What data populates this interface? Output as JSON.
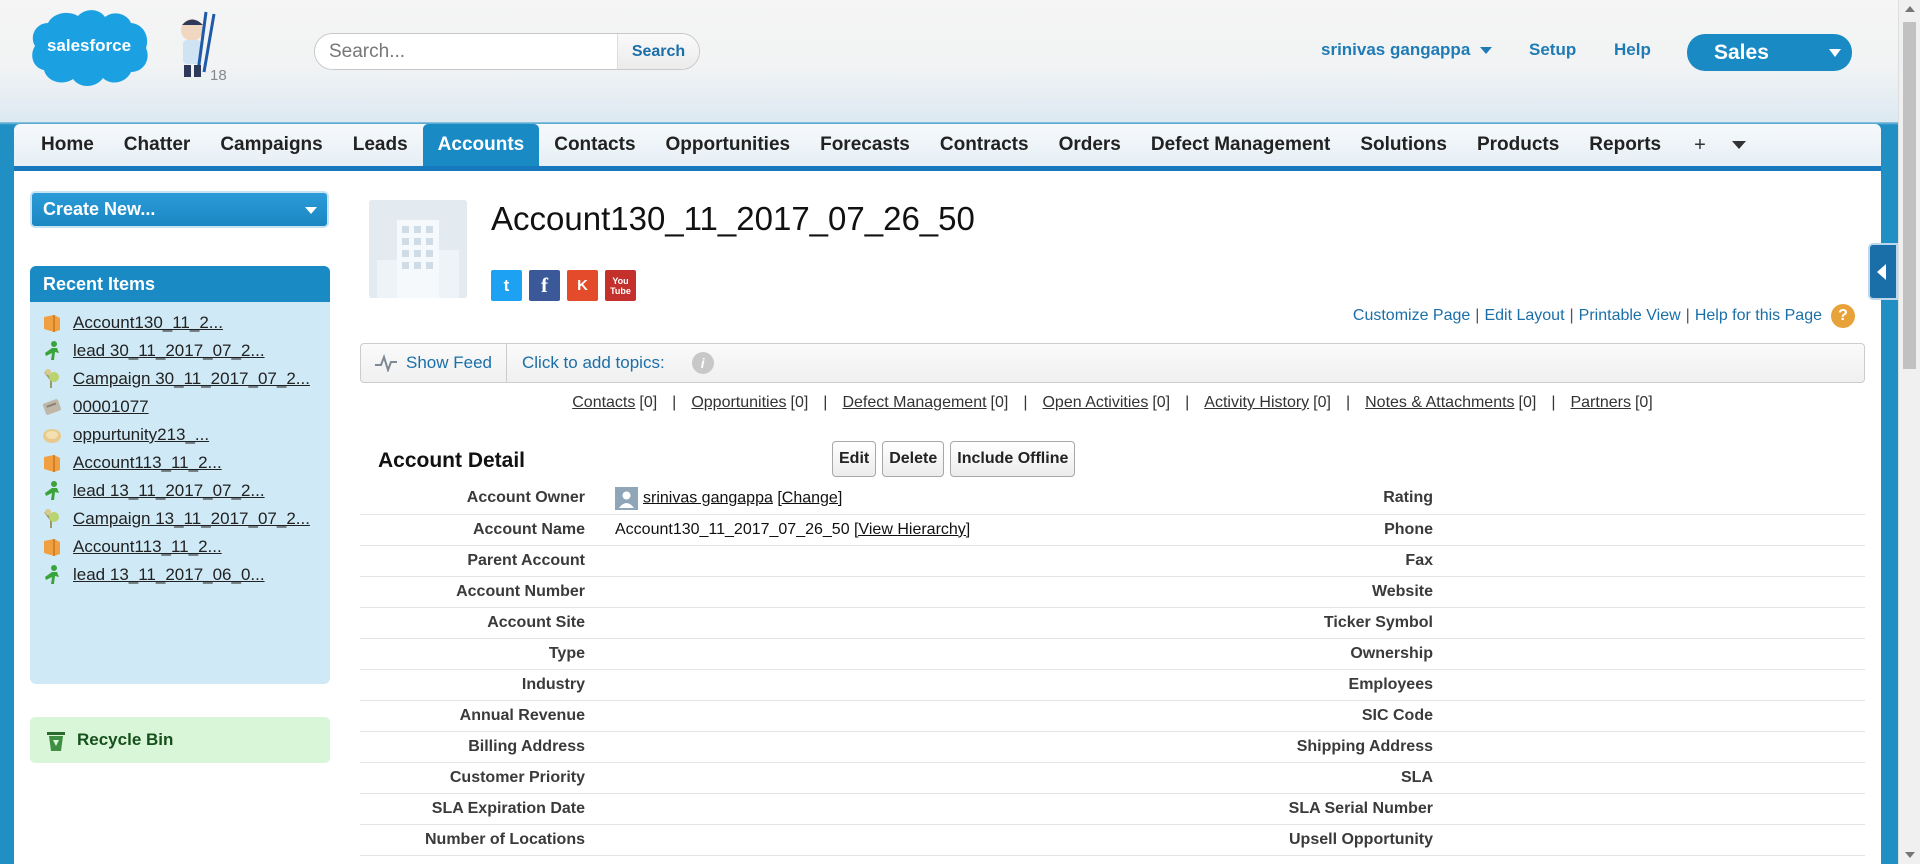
{
  "header": {
    "logo_text": "salesforce",
    "mascot_badge": "18",
    "search": {
      "placeholder": "Search...",
      "button_label": "Search"
    },
    "user_name": "srinivas gangappa",
    "setup_label": "Setup",
    "help_label": "Help",
    "app_name": "Sales"
  },
  "tabs": [
    {
      "label": "Home"
    },
    {
      "label": "Chatter"
    },
    {
      "label": "Campaigns"
    },
    {
      "label": "Leads"
    },
    {
      "label": "Accounts",
      "active": true
    },
    {
      "label": "Contacts"
    },
    {
      "label": "Opportunities"
    },
    {
      "label": "Forecasts"
    },
    {
      "label": "Contracts"
    },
    {
      "label": "Orders"
    },
    {
      "label": "Defect Management"
    },
    {
      "label": "Solutions"
    },
    {
      "label": "Products"
    },
    {
      "label": "Reports"
    }
  ],
  "tab_plus": "+",
  "sidebar": {
    "create_new": "Create New...",
    "recent_title": "Recent Items",
    "recent_items": [
      {
        "label": "Account130_11_2...",
        "icon": "account-icon"
      },
      {
        "label": "lead 30_11_2017_07_2...",
        "icon": "lead-icon"
      },
      {
        "label": "Campaign 30_11_2017_07_2...",
        "icon": "campaign-icon"
      },
      {
        "label": "00001077",
        "icon": "order-icon"
      },
      {
        "label": "oppurtunity213_...",
        "icon": "opportunity-icon"
      },
      {
        "label": "Account113_11_2...",
        "icon": "account-icon"
      },
      {
        "label": "lead 13_11_2017_07_2...",
        "icon": "lead-icon"
      },
      {
        "label": "Campaign 13_11_2017_07_2...",
        "icon": "campaign-icon"
      },
      {
        "label": "Account113_11_2...",
        "icon": "account-icon"
      },
      {
        "label": "lead 13_11_2017_06_0...",
        "icon": "lead-icon"
      }
    ],
    "recycle_bin": "Recycle Bin"
  },
  "account": {
    "title": "Account130_11_2017_07_26_50",
    "social": {
      "twitter": "t",
      "facebook": "f",
      "klout": "K",
      "youtube": "You Tube"
    }
  },
  "page_links": {
    "customize": "Customize Page",
    "edit_layout": "Edit Layout",
    "printable": "Printable View",
    "help": "Help for this Page",
    "separator": "|",
    "help_icon": "?"
  },
  "feed": {
    "show_feed": "Show Feed",
    "topics": "Click to add topics:",
    "info": "i"
  },
  "related_links": [
    {
      "label": "Contacts",
      "count": "[0]"
    },
    {
      "label": "Opportunities",
      "count": "[0]"
    },
    {
      "label": "Defect Management",
      "count": "[0]"
    },
    {
      "label": "Open Activities",
      "count": "[0]"
    },
    {
      "label": "Activity History",
      "count": "[0]"
    },
    {
      "label": "Notes & Attachments",
      "count": "[0]"
    },
    {
      "label": "Partners",
      "count": "[0]"
    }
  ],
  "detail": {
    "title": "Account Detail",
    "buttons": {
      "edit": "Edit",
      "delete": "Delete",
      "include_offline": "Include Offline"
    },
    "rows": [
      {
        "left_label": "Account Owner",
        "left_value": "srinivas gangappa",
        "left_extra": "[Change]",
        "right_label": "Rating"
      },
      {
        "left_label": "Account Name",
        "left_value": "Account130_11_2017_07_26_50",
        "left_extra": "[View Hierarchy]",
        "right_label": "Phone"
      },
      {
        "left_label": "Parent Account",
        "right_label": "Fax"
      },
      {
        "left_label": "Account Number",
        "right_label": "Website"
      },
      {
        "left_label": "Account Site",
        "right_label": "Ticker Symbol"
      },
      {
        "left_label": "Type",
        "right_label": "Ownership"
      },
      {
        "left_label": "Industry",
        "right_label": "Employees"
      },
      {
        "left_label": "Annual Revenue",
        "right_label": "SIC Code"
      },
      {
        "left_label": "Billing Address",
        "right_label": "Shipping Address"
      },
      {
        "left_label": "Customer Priority",
        "right_label": "SLA"
      },
      {
        "left_label": "SLA Expiration Date",
        "right_label": "SLA Serial Number"
      },
      {
        "left_label": "Number of Locations",
        "right_label": "Upsell Opportunity"
      }
    ]
  },
  "colors": {
    "brand_blue": "#1a8ac5",
    "link_blue": "#1a6fa8",
    "tab_underline": "#1878bd",
    "recent_bg": "#cfeaf6",
    "recycle_bg": "#d9f7d8"
  }
}
